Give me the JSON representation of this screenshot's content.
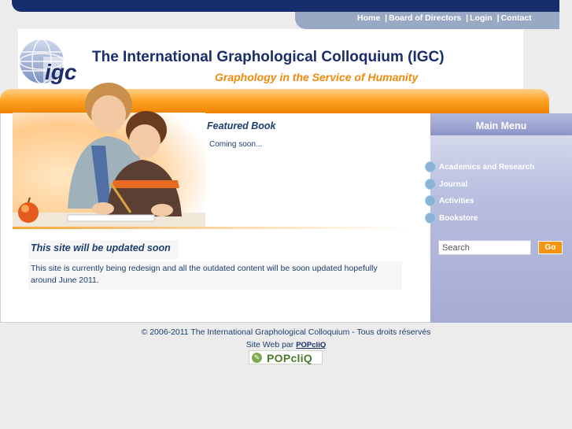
{
  "nav": {
    "items": [
      "Home",
      "Board of Directors",
      "Login",
      "Contact"
    ],
    "separator": "|"
  },
  "header": {
    "logo_text": "IGC",
    "title": "The International Graphological Colloquium (IGC)",
    "slogan": "Graphology in the Service of Humanity"
  },
  "featured": {
    "title": "Featured Book",
    "text": "Coming soon..."
  },
  "update": {
    "title": "This site will be updated soon",
    "text": "This site is currently being redesign and all the outdated content will be soon updated hopefully around June 2011."
  },
  "sidebar": {
    "heading": "Main Menu",
    "items": [
      "Academics and Research",
      "Journal",
      "Activities",
      "Bookstore"
    ],
    "search_placeholder": "Search",
    "go_label": "Go"
  },
  "footer": {
    "copyright": "© 2006-2011 The International Graphological Colloquium - Tous droits réservés",
    "credit_prefix": "Site Web par",
    "credit_link": "POPcliQ",
    "badge_text": "POPcliQ"
  },
  "colors": {
    "navy": "#162d6e",
    "orange": "#f08a0b",
    "sidebar": "#a7aad3"
  }
}
